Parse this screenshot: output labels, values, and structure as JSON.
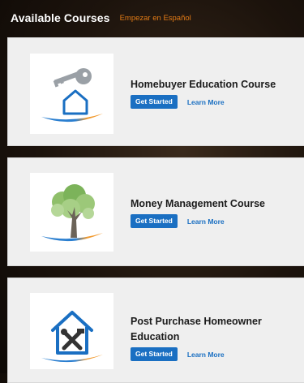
{
  "header": {
    "title": "Available Courses",
    "spanish_link": "Empezar en Español"
  },
  "courses": [
    {
      "title": "Homebuyer Education Course",
      "icon": "house-key-icon",
      "get_started": "Get Started",
      "learn_more": "Learn More"
    },
    {
      "title": "Money Management Course",
      "icon": "tree-icon",
      "get_started": "Get Started",
      "learn_more": "Learn More"
    },
    {
      "title": "Post Purchase Homeowner Education",
      "icon": "house-tools-icon",
      "get_started": "Get Started",
      "learn_more": "Learn More"
    }
  ],
  "colors": {
    "accent_blue": "#1a6fc2",
    "spanish_link": "#e07a16",
    "swoosh_orange": "#f29a2e",
    "swoosh_blue": "#2b7fd0"
  }
}
